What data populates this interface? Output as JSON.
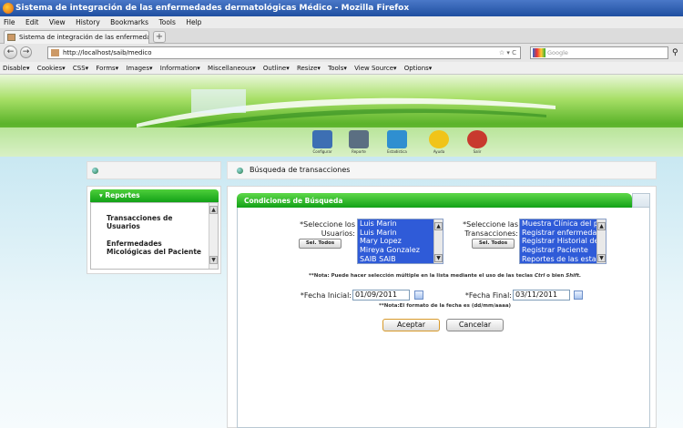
{
  "browser": {
    "window_title": "Sistema de integración de las enfermedades dermatológicas Médico - Mozilla Firefox",
    "menu": [
      "File",
      "Edit",
      "View",
      "History",
      "Bookmarks",
      "Tools",
      "Help"
    ],
    "tab_title": "Sistema de integración de las enfermedades ...",
    "new_tab": "+",
    "back": "←",
    "forward": "→",
    "url": "http://localhost/saib/medico",
    "url_right": "☆ ▾  C",
    "search_placeholder": "Google",
    "webdev_toolbar": [
      "Disable▾",
      "Cookies▾",
      "CSS▾",
      "Forms▾",
      "Images▾",
      "Information▾",
      "Miscellaneous▾",
      "Outline▾",
      "Resize▾",
      "Tools▾",
      "View Source▾",
      "Options▾"
    ]
  },
  "header": {
    "icons": [
      {
        "name": "configure-icon",
        "label": "Configurar",
        "color": "#3d6fb3"
      },
      {
        "name": "report-icon",
        "label": "Reporte",
        "color": "#5b6f82"
      },
      {
        "name": "stats-icon",
        "label": "Estadística",
        "color": "#2f8fd0"
      },
      {
        "name": "help-icon",
        "label": "Ayuda",
        "color": "#f0c419"
      },
      {
        "name": "exit-icon",
        "label": "Salir",
        "color": "#c83a2e"
      }
    ]
  },
  "sidebar": {
    "section_title": "Reportes",
    "items": [
      "Transacciones de Usuarios",
      "Enfermedades Micológicas del Paciente"
    ]
  },
  "main": {
    "title": "Búsqueda de transacciones",
    "conditions_title": "Condiciones de Búsqueda",
    "users_label": "*Seleccione los Usuarios:",
    "users": [
      "Luis Marin",
      "Luis Marin",
      "Mary Lopez",
      "Mireya Gonzalez",
      "SAIB SAIB"
    ],
    "select_all_users": "Sel. Todos",
    "transactions_label": "*Seleccione las Transacciones:",
    "transactions": [
      "Muestra Clínica del pa",
      "Registrar enfermedad",
      "Registrar Historial de",
      "Registrar Paciente",
      "Reportes de las estad"
    ],
    "select_all_transactions": "Sel. Todos",
    "multi_note_prefix": "**Nota: Puede hacer selección múltiple en la lista mediante el uso de las teclas ",
    "multi_note_key1": "Ctrl",
    "multi_note_mid": " o bien ",
    "multi_note_key2": "Shift.",
    "start_label": "*Fecha Inicial:",
    "start_date": "01/09/2011",
    "end_label": "*Fecha Final:",
    "end_date": "03/11/2011",
    "date_note": "**Nota:El formato de la fecha es (dd/mm/aaaa)",
    "accept": "Aceptar",
    "cancel": "Cancelar"
  },
  "colors": {
    "green_bar": "#12a117",
    "selection_blue": "#2f5bd8",
    "title_blue": "#1f4fa0"
  }
}
